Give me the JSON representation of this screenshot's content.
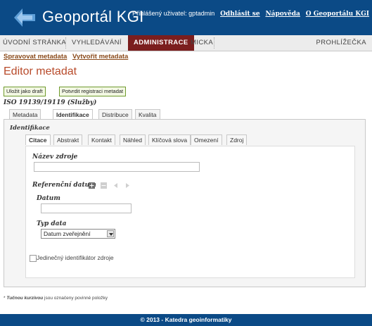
{
  "header": {
    "site_title": "Geoportál KGI",
    "user_text": "Přihlášený uživatel: gptadmin",
    "logout_label": "Odhlásit se",
    "help_label": "Nápověda",
    "about_label": "O Geoportálu KGI",
    "colors": {
      "background": "#0b4a86"
    }
  },
  "nav": {
    "items": [
      {
        "label": "ÚVODNÍ STRÁNKA"
      },
      {
        "label": "VYHLEDÁVÁNÍ"
      },
      {
        "label": "ADMINISTRACE",
        "active": true
      },
      {
        "label": "MICKA"
      }
    ],
    "right_item": "PROHLÍŽEČKA",
    "active_color": "#7b1e1e"
  },
  "sublinks": {
    "manage": "Spravovat metadata",
    "create": "Vytvořit metadata"
  },
  "page_title": "Editor metadat",
  "buttons": {
    "save_draft": "Uložit jako draft",
    "confirm_registration": "Potvrdit registraci metadat"
  },
  "standard_label": "ISO 19139/19119 (Služby)",
  "main_tabs": [
    {
      "label": "Metadata"
    },
    {
      "label": "Identifikace",
      "active": true
    },
    {
      "label": "Distribuce"
    },
    {
      "label": "Kvalita"
    }
  ],
  "section_label": "Identifikace",
  "sub_tabs": [
    {
      "label": "Citace",
      "active": true
    },
    {
      "label": "Abstrakt"
    },
    {
      "label": "Kontakt"
    },
    {
      "label": "Náhled"
    },
    {
      "label": "Klíčová slova"
    },
    {
      "label": "Omezení"
    },
    {
      "label": "Zdroj"
    }
  ],
  "form": {
    "resource_name_label": "Název zdroje",
    "resource_name_value": "",
    "reference_date_label": "Referenční datum",
    "reference_date_controls": [
      "add-icon",
      "remove-icon",
      "arrow-left-icon",
      "arrow-right-icon"
    ],
    "date_label": "Datum",
    "date_value": "",
    "date_type_label": "Typ data",
    "date_type_value": "Datum zveřejnění",
    "unique_id_label": "Jedinečný identifikátor zdroje",
    "unique_id_checked": false
  },
  "footnote": {
    "bold": "Tučnou kurzívou",
    "rest": " jsou označeny povinné položky"
  },
  "footer": "© 2013 - Katedra geoinformatiky"
}
